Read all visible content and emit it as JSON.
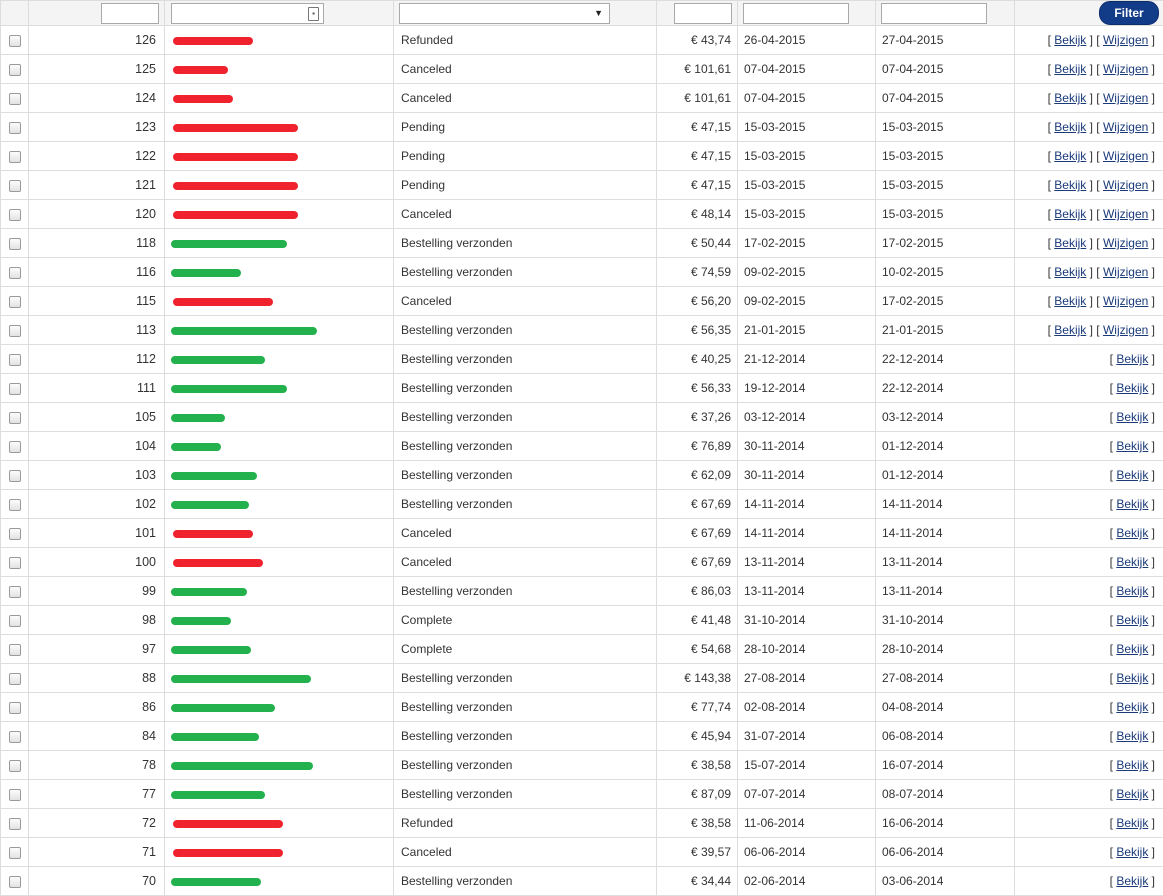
{
  "filter": {
    "id_value": "",
    "customer_value": "",
    "status_value": "",
    "amount_value": "",
    "date_from_value": "",
    "date_to_value": "",
    "button_label": "Filter"
  },
  "action_labels": {
    "view": "Bekijk",
    "edit": "Wijzigen"
  },
  "colors": {
    "accent": "#123c88",
    "redacted_red": "#f0222e",
    "redacted_green": "#22b14c"
  },
  "orders": [
    {
      "id": "126",
      "status": "Refunded",
      "amount": "€ 43,74",
      "created": "26-04-2015",
      "updated": "27-04-2015",
      "redaction": "red",
      "editable": true
    },
    {
      "id": "125",
      "status": "Canceled",
      "amount": "€ 101,61",
      "created": "07-04-2015",
      "updated": "07-04-2015",
      "redaction": "red",
      "editable": true
    },
    {
      "id": "124",
      "status": "Canceled",
      "amount": "€ 101,61",
      "created": "07-04-2015",
      "updated": "07-04-2015",
      "redaction": "red",
      "editable": true
    },
    {
      "id": "123",
      "status": "Pending",
      "amount": "€ 47,15",
      "created": "15-03-2015",
      "updated": "15-03-2015",
      "redaction": "red",
      "editable": true
    },
    {
      "id": "122",
      "status": "Pending",
      "amount": "€ 47,15",
      "created": "15-03-2015",
      "updated": "15-03-2015",
      "redaction": "red",
      "editable": true
    },
    {
      "id": "121",
      "status": "Pending",
      "amount": "€ 47,15",
      "created": "15-03-2015",
      "updated": "15-03-2015",
      "redaction": "red",
      "editable": true
    },
    {
      "id": "120",
      "status": "Canceled",
      "amount": "€ 48,14",
      "created": "15-03-2015",
      "updated": "15-03-2015",
      "redaction": "red",
      "editable": true
    },
    {
      "id": "118",
      "status": "Bestelling verzonden",
      "amount": "€ 50,44",
      "created": "17-02-2015",
      "updated": "17-02-2015",
      "redaction": "green",
      "editable": true
    },
    {
      "id": "116",
      "status": "Bestelling verzonden",
      "amount": "€ 74,59",
      "created": "09-02-2015",
      "updated": "10-02-2015",
      "redaction": "green",
      "editable": true
    },
    {
      "id": "115",
      "status": "Canceled",
      "amount": "€ 56,20",
      "created": "09-02-2015",
      "updated": "17-02-2015",
      "redaction": "red",
      "editable": true
    },
    {
      "id": "113",
      "status": "Bestelling verzonden",
      "amount": "€ 56,35",
      "created": "21-01-2015",
      "updated": "21-01-2015",
      "redaction": "green",
      "editable": true
    },
    {
      "id": "112",
      "status": "Bestelling verzonden",
      "amount": "€ 40,25",
      "created": "21-12-2014",
      "updated": "22-12-2014",
      "redaction": "green",
      "editable": false
    },
    {
      "id": "111",
      "status": "Bestelling verzonden",
      "amount": "€ 56,33",
      "created": "19-12-2014",
      "updated": "22-12-2014",
      "redaction": "green",
      "editable": false
    },
    {
      "id": "105",
      "status": "Bestelling verzonden",
      "amount": "€ 37,26",
      "created": "03-12-2014",
      "updated": "03-12-2014",
      "redaction": "green",
      "editable": false
    },
    {
      "id": "104",
      "status": "Bestelling verzonden",
      "amount": "€ 76,89",
      "created": "30-11-2014",
      "updated": "01-12-2014",
      "redaction": "green",
      "editable": false
    },
    {
      "id": "103",
      "status": "Bestelling verzonden",
      "amount": "€ 62,09",
      "created": "30-11-2014",
      "updated": "01-12-2014",
      "redaction": "green",
      "editable": false
    },
    {
      "id": "102",
      "status": "Bestelling verzonden",
      "amount": "€ 67,69",
      "created": "14-11-2014",
      "updated": "14-11-2014",
      "redaction": "green",
      "editable": false
    },
    {
      "id": "101",
      "status": "Canceled",
      "amount": "€ 67,69",
      "created": "14-11-2014",
      "updated": "14-11-2014",
      "redaction": "red",
      "editable": false
    },
    {
      "id": "100",
      "status": "Canceled",
      "amount": "€ 67,69",
      "created": "13-11-2014",
      "updated": "13-11-2014",
      "redaction": "red",
      "editable": false
    },
    {
      "id": "99",
      "status": "Bestelling verzonden",
      "amount": "€ 86,03",
      "created": "13-11-2014",
      "updated": "13-11-2014",
      "redaction": "green",
      "editable": false
    },
    {
      "id": "98",
      "status": "Complete",
      "amount": "€ 41,48",
      "created": "31-10-2014",
      "updated": "31-10-2014",
      "redaction": "green",
      "editable": false
    },
    {
      "id": "97",
      "status": "Complete",
      "amount": "€ 54,68",
      "created": "28-10-2014",
      "updated": "28-10-2014",
      "redaction": "green",
      "editable": false
    },
    {
      "id": "88",
      "status": "Bestelling verzonden",
      "amount": "€ 143,38",
      "created": "27-08-2014",
      "updated": "27-08-2014",
      "redaction": "green",
      "editable": false
    },
    {
      "id": "86",
      "status": "Bestelling verzonden",
      "amount": "€ 77,74",
      "created": "02-08-2014",
      "updated": "04-08-2014",
      "redaction": "green",
      "editable": false
    },
    {
      "id": "84",
      "status": "Bestelling verzonden",
      "amount": "€ 45,94",
      "created": "31-07-2014",
      "updated": "06-08-2014",
      "redaction": "green",
      "editable": false
    },
    {
      "id": "78",
      "status": "Bestelling verzonden",
      "amount": "€ 38,58",
      "created": "15-07-2014",
      "updated": "16-07-2014",
      "redaction": "green",
      "editable": false
    },
    {
      "id": "77",
      "status": "Bestelling verzonden",
      "amount": "€ 87,09",
      "created": "07-07-2014",
      "updated": "08-07-2014",
      "redaction": "green",
      "editable": false
    },
    {
      "id": "72",
      "status": "Refunded",
      "amount": "€ 38,58",
      "created": "11-06-2014",
      "updated": "16-06-2014",
      "redaction": "red",
      "editable": false
    },
    {
      "id": "71",
      "status": "Canceled",
      "amount": "€ 39,57",
      "created": "06-06-2014",
      "updated": "06-06-2014",
      "redaction": "red",
      "editable": false
    },
    {
      "id": "70",
      "status": "Bestelling verzonden",
      "amount": "€ 34,44",
      "created": "02-06-2014",
      "updated": "03-06-2014",
      "redaction": "green",
      "editable": false
    }
  ]
}
